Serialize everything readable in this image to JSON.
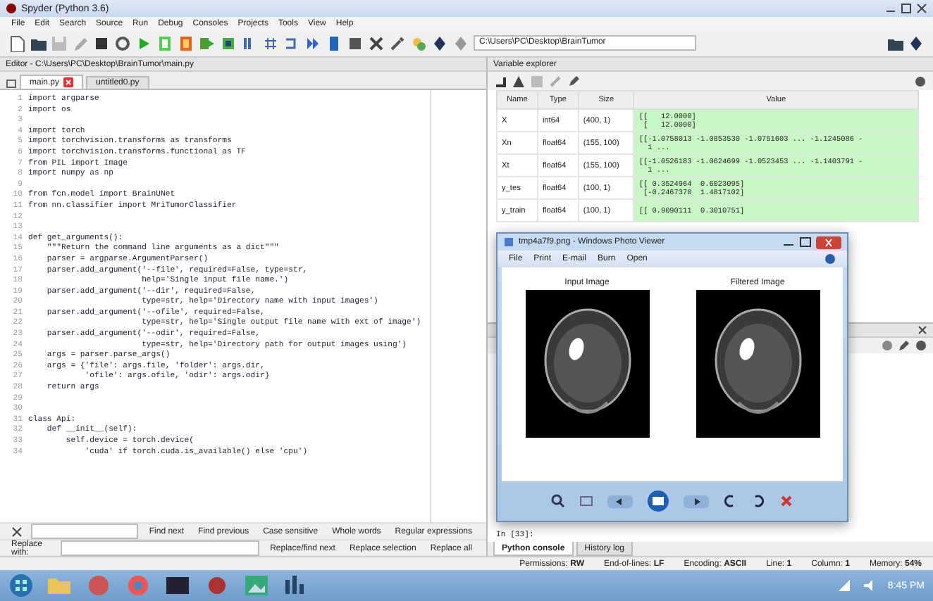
{
  "window": {
    "title": "Spyder (Python 3.6)"
  },
  "menu": [
    "File",
    "Edit",
    "Search",
    "Source",
    "Run",
    "Debug",
    "Consoles",
    "Projects",
    "Tools",
    "View",
    "Help"
  ],
  "toolbar": {
    "working_directory": "C:\\Users\\PC\\Desktop\\BrainTumor"
  },
  "editor": {
    "title": "Editor - C:\\Users\\PC\\Desktop\\BrainTumor\\main.py",
    "tabs": [
      {
        "label": "main.py",
        "selected": true
      },
      {
        "label": "untitled0.py",
        "selected": false
      }
    ],
    "lines": [
      {
        "number": "1",
        "text": "import argparse"
      },
      {
        "number": "2",
        "text": "import os"
      },
      {
        "number": "3"
      },
      {
        "number": "4",
        "text": "import torch"
      },
      {
        "number": "5",
        "text": "import torchvision.transforms as transforms"
      },
      {
        "number": "6",
        "text": "import torchvision.transforms.functional as TF"
      },
      {
        "number": "7",
        "text": "from PIL import Image"
      },
      {
        "number": "8",
        "text": "import numpy as np"
      },
      {
        "number": "9"
      },
      {
        "number": "10",
        "text": "from fcn.model import BrainUNet"
      },
      {
        "number": "11",
        "text": "from nn.classifier import MriTumorClassifier"
      },
      {
        "number": "12"
      },
      {
        "number": "13"
      },
      {
        "number": "14",
        "text": "def get_arguments():"
      },
      {
        "number": "15",
        "text": "    \"\"\"Return the command line arguments as a dict\"\"\""
      },
      {
        "number": "16",
        "text": "    parser = argparse.ArgumentParser()"
      },
      {
        "number": "17",
        "text": "    parser.add_argument('--file', required=False, type=str,"
      },
      {
        "number": "18",
        "text": "                        help='Single input file name.')"
      },
      {
        "number": "19",
        "text": "    parser.add_argument('--dir', required=False,"
      },
      {
        "number": "20",
        "text": "                        type=str, help='Directory name with input images')"
      },
      {
        "number": "21",
        "text": "    parser.add_argument('--ofile', required=False,"
      },
      {
        "number": "22",
        "text": "                        type=str, help='Single output file name with ext of image')"
      },
      {
        "number": "23",
        "text": "    parser.add_argument('--odir', required=False,"
      },
      {
        "number": "24",
        "text": "                        type=str, help='Directory path for output images using')"
      },
      {
        "number": "25",
        "text": "    args = parser.parse_args()"
      },
      {
        "number": "26",
        "text": "    args = {'file': args.file, 'folder': args.dir,"
      },
      {
        "number": "27",
        "text": "            'ofile': args.ofile, 'odir': args.odir}"
      },
      {
        "number": "28",
        "text": "    return args"
      },
      {
        "number": "29"
      },
      {
        "number": "30"
      },
      {
        "number": "31",
        "text": "class Api:"
      },
      {
        "number": "32",
        "text": "    def __init__(self):"
      },
      {
        "number": "33",
        "text": "        self.device = torch.device("
      },
      {
        "number": "34",
        "text": "            'cuda' if torch.cuda.is_available() else 'cpu')"
      }
    ]
  },
  "variable_explorer": {
    "title": "Variable explorer",
    "columns": [
      "Name",
      "Type",
      "Size",
      "Value"
    ],
    "rows": [
      {
        "name": "X",
        "type": "int64",
        "size": "(400, 1)",
        "value": "[[   12.0000]\n [   12.0000]"
      },
      {
        "name": "Xn",
        "type": "float64",
        "size": "(155, 100)",
        "value": "[[-1.0758013 -1.0853530 -1.0751603 ... -1.1245086 -\n  1 ..."
      },
      {
        "name": "Xt",
        "type": "float64",
        "size": "(155, 100)",
        "value": "[[-1.0526183 -1.0624699 -1.0523453 ... -1.1403791 -\n  1 ..."
      },
      {
        "name": "y_tes",
        "type": "float64",
        "size": "(100, 1)",
        "value": "[[ 0.3524964  0.6023095]\n [-0.2467370  1.4817102]"
      },
      {
        "name": "y_train",
        "type": "float64",
        "size": "(100, 1)",
        "value": "[[ 0.9090111  0.3010751]"
      }
    ]
  },
  "console": {
    "lines": [
      "In [33]:"
    ],
    "tabs": [
      {
        "label": "Python console",
        "selected": true
      },
      {
        "label": "History log",
        "selected": false
      }
    ]
  },
  "find_bar": {
    "buttons": [
      "Find next",
      "Find previous",
      "Case sensitive",
      "Whole words",
      "Regular expressions"
    ]
  },
  "replace_bar": {
    "label": "Replace with:",
    "buttons": [
      "Replace/find next",
      "Replace selection",
      "Replace all"
    ]
  },
  "status_bar": [
    {
      "label": "Permissions:",
      "value": "RW"
    },
    {
      "label": "End-of-lines:",
      "value": "LF"
    },
    {
      "label": "Encoding:",
      "value": "ASCII"
    },
    {
      "label": "Line:",
      "value": "1"
    },
    {
      "label": "Column:",
      "value": "1"
    },
    {
      "label": "Memory:",
      "value": "54%"
    }
  ],
  "photo_viewer": {
    "title": "tmp4a7f9.png - Windows Photo Viewer",
    "menu": [
      "File",
      "Print",
      "E-mail",
      "Burn",
      "Open"
    ],
    "images": [
      {
        "title": "Input Image"
      },
      {
        "title": "Filtered Image"
      }
    ]
  },
  "taskbar": {
    "clock": "8:45 PM"
  }
}
